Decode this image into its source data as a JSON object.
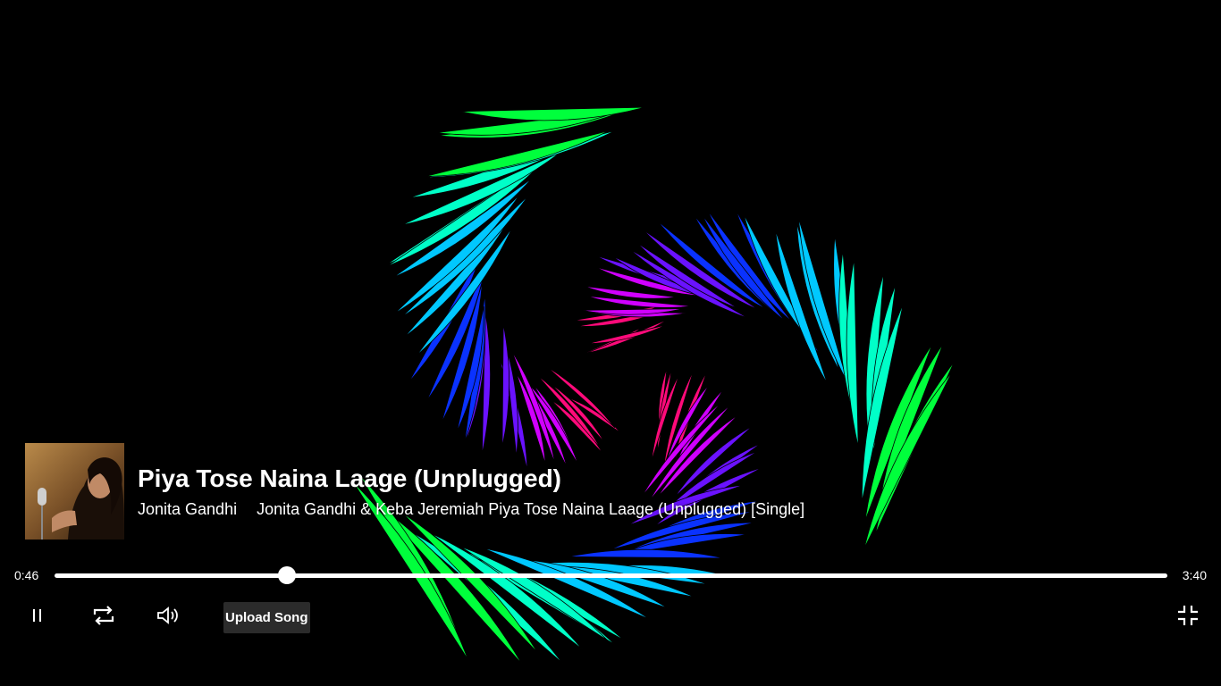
{
  "player": {
    "title": "Piya Tose Naina Laage (Unplugged)",
    "artist": "Jonita Gandhi",
    "details": "Jonita Gandhi & Keba Jeremiah Piya Tose Naina Laage (Unplugged) [Single]",
    "current_time": "0:46",
    "total_time": "3:40",
    "progress_fraction": 0.209
  },
  "controls": {
    "play_pause_icon": "pause-icon",
    "repeat_icon": "repeat-icon",
    "volume_icon": "volume-icon",
    "upload_label": "Upload Song",
    "fullscreen_icon": "exit-fullscreen-icon"
  },
  "visualizer": {
    "style": "spiral",
    "colors": [
      "#00ff3c",
      "#00ffc8",
      "#00c8ff",
      "#0a32ff",
      "#6a12ff",
      "#d000ff",
      "#ff0a7a"
    ]
  }
}
